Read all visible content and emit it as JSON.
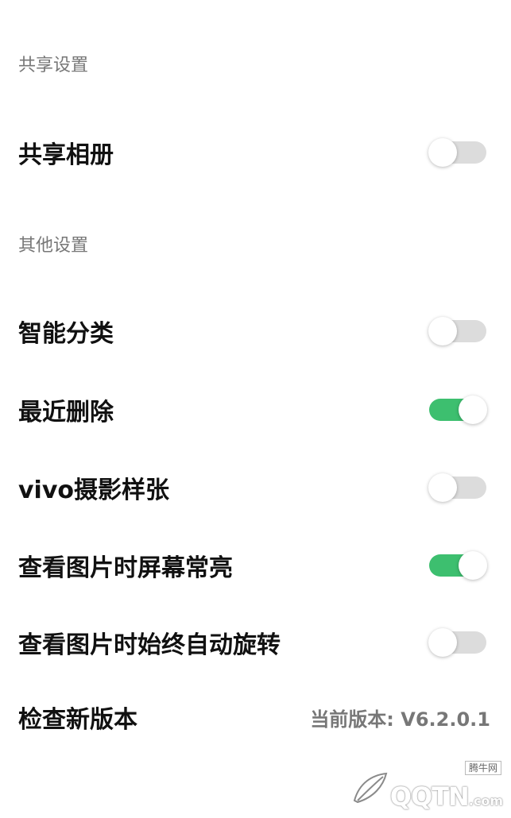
{
  "sections": [
    {
      "title": "共享设置"
    },
    {
      "title": "其他设置"
    }
  ],
  "settings": {
    "share_album": {
      "label": "共享相册",
      "enabled": false
    },
    "smart_classify": {
      "label": "智能分类",
      "enabled": false
    },
    "recently_deleted": {
      "label": "最近删除",
      "enabled": true
    },
    "vivo_samples": {
      "label": "vivo摄影样张",
      "enabled": false
    },
    "keep_screen_on": {
      "label": "查看图片时屏幕常亮",
      "enabled": true
    },
    "auto_rotate": {
      "label": "查看图片时始终自动旋转",
      "enabled": false
    },
    "check_update": {
      "label": "检查新版本",
      "version_text": "当前版本: V6.2.0.1"
    }
  },
  "watermark": {
    "brand": "QQTN",
    "domain": ".com",
    "tag": "腾牛网",
    "icon": "leaf-logo-icon"
  },
  "colors": {
    "toggle_on": "#3dbf6f",
    "toggle_off": "#dcdcdc",
    "section_header": "#777777",
    "text_primary": "#111111"
  }
}
